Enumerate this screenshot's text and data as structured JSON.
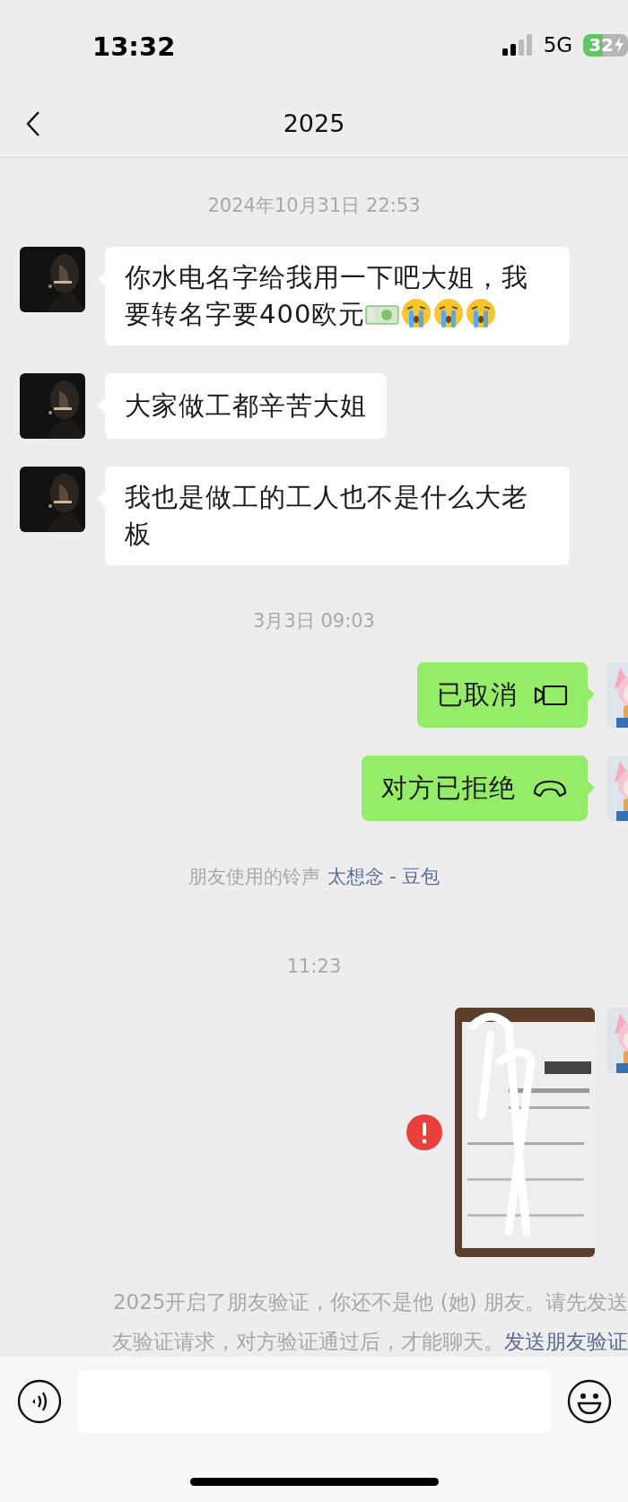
{
  "status_bar": {
    "time": "13:32",
    "network": "5G",
    "battery": "32"
  },
  "nav": {
    "title": "2025"
  },
  "messages": [
    {
      "kind": "timestamp",
      "text": "2024年10月31日 22:53"
    },
    {
      "kind": "incoming_text",
      "text": "你水电名字给我用一下吧大姐，我要转名字要400欧元",
      "emoji": [
        {
          "kind": "banknote"
        },
        {
          "kind": "crying"
        },
        {
          "kind": "crying"
        },
        {
          "kind": "crying"
        }
      ]
    },
    {
      "kind": "incoming_text",
      "text": "大家做工都辛苦大姐"
    },
    {
      "kind": "incoming_text",
      "text": "我也是做工的工人也不是什么大老板"
    },
    {
      "kind": "timestamp",
      "text": "3月3日 09:03"
    },
    {
      "kind": "outgoing_call",
      "text": "已取消",
      "icon": {
        "kind": "video"
      }
    },
    {
      "kind": "outgoing_call",
      "text": "对方已拒绝",
      "icon": {
        "kind": "voice"
      }
    },
    {
      "kind": "system",
      "text": "朋友使用的铃声",
      "link": "太想念 - 豆包"
    },
    {
      "kind": "timestamp",
      "text": "11:23"
    },
    {
      "kind": "outgoing_image",
      "failed": true
    }
  ],
  "notice": {
    "lines": [
      "2025开启了朋友验证，你还不是他 (她) 朋友。请先发送",
      "友验证请求，对方验证通过后，才能聊天。"
    ],
    "link": "发送朋友验证"
  }
}
